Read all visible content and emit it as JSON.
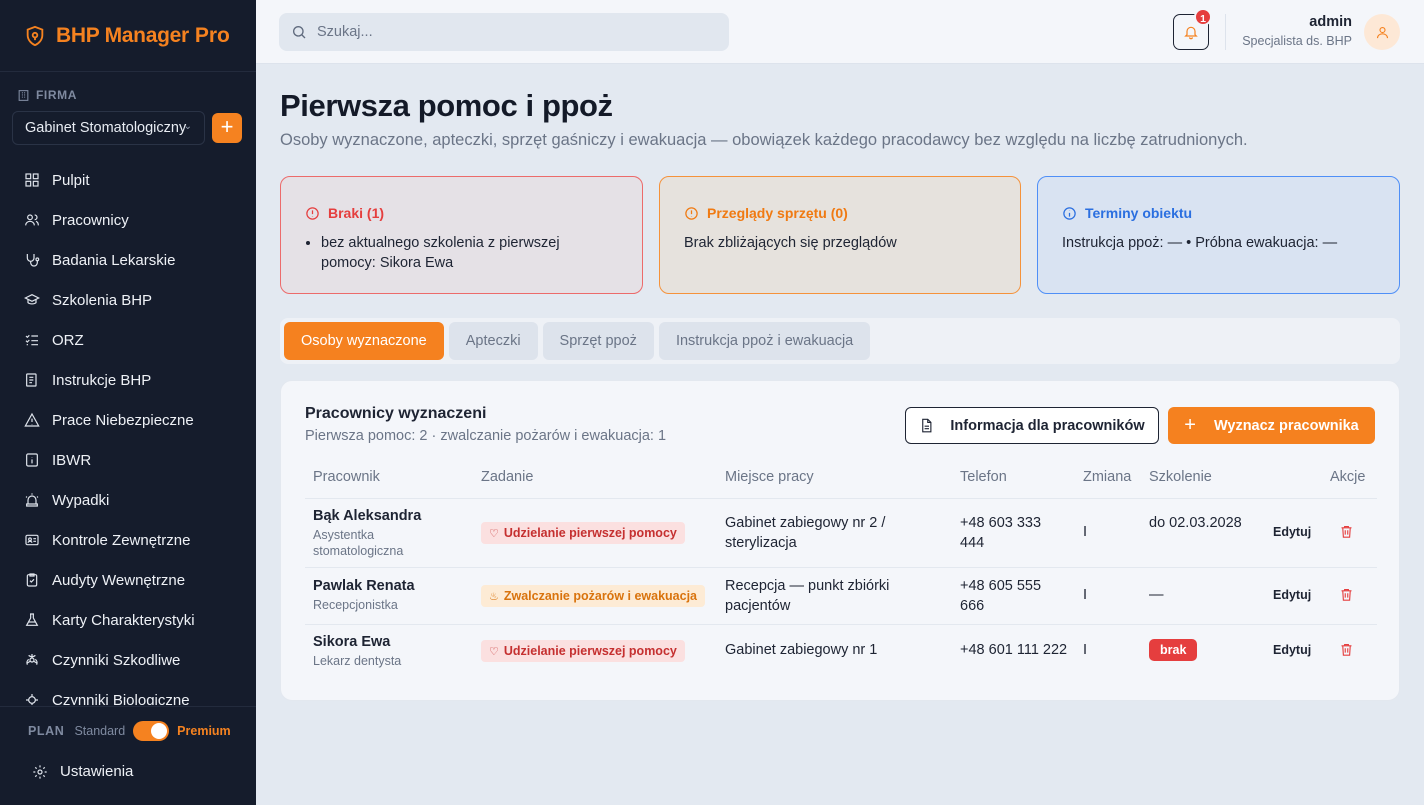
{
  "brand": {
    "name": "BHP Manager",
    "suffix": "Pro"
  },
  "sidebar": {
    "firma_label": "FIRMA",
    "company": "Gabinet Stomatologiczny",
    "add_label": "+",
    "items": [
      {
        "label": "Pulpit",
        "icon": "grid-icon"
      },
      {
        "label": "Pracownicy",
        "icon": "users-icon"
      },
      {
        "label": "Badania Lekarskie",
        "icon": "stethoscope-icon"
      },
      {
        "label": "Szkolenia BHP",
        "icon": "graduation-cap-icon"
      },
      {
        "label": "ORZ",
        "icon": "checklist-icon"
      },
      {
        "label": "Instrukcje BHP",
        "icon": "document-list-icon"
      },
      {
        "label": "Prace Niebezpieczne",
        "icon": "warning-triangle-icon"
      },
      {
        "label": "IBWR",
        "icon": "info-box-icon"
      },
      {
        "label": "Wypadki",
        "icon": "siren-icon"
      },
      {
        "label": "Kontrole Zewnętrzne",
        "icon": "id-card-icon"
      },
      {
        "label": "Audyty Wewnętrzne",
        "icon": "clipboard-check-icon"
      },
      {
        "label": "Karty Charakterystyki",
        "icon": "flask-icon"
      },
      {
        "label": "Czynniki Szkodliwe",
        "icon": "biohazard-icon"
      },
      {
        "label": "Czynniki Biologiczne",
        "icon": "microbe-icon"
      }
    ],
    "plan": {
      "label": "PLAN",
      "standard": "Standard",
      "premium": "Premium",
      "premium_on": true
    },
    "settings": "Ustawienia"
  },
  "topbar": {
    "search_placeholder": "Szukaj...",
    "notifications": "1",
    "user_name": "admin",
    "user_role": "Specjalista ds. BHP"
  },
  "page": {
    "title": "Pierwsza pomoc i ppoż",
    "subtitle": "Osoby wyznaczone, apteczki, sprzęt gaśniczy i ewakuacja — obowiązek każdego pracodawcy bez względu na liczbę zatrudnionych."
  },
  "alerts": {
    "braki": {
      "title": "Braki (1)",
      "items": [
        "bez aktualnego szkolenia z pierwszej pomocy: Sikora Ewa"
      ]
    },
    "przeglady": {
      "title": "Przeglądy sprzętu (0)",
      "body": "Brak zbliżających się przeglądów"
    },
    "terminy": {
      "title": "Terminy obiektu",
      "body": "Instrukcja ppoż: — • Próbna ewakuacja: —"
    }
  },
  "tabs": [
    "Osoby wyznaczone",
    "Apteczki",
    "Sprzęt ppoż",
    "Instrukcja ppoż i ewakuacja"
  ],
  "card": {
    "title": "Pracownicy wyznaczeni",
    "subtitle": "Pierwsza pomoc: 2 · zwalczanie pożarów i ewakuacja: 1",
    "info_button": "Informacja dla pracowników",
    "add_button": "Wyznacz pracownika",
    "columns": [
      "Pracownik",
      "Zadanie",
      "Miejsce pracy",
      "Telefon",
      "Zmiana",
      "Szkolenie",
      "Akcje"
    ],
    "rows": [
      {
        "name": "Bąk Aleksandra",
        "role": "Asystentka stomatologiczna",
        "task": "Udzielanie pierwszej pomocy",
        "task_type": "first-aid",
        "place": "Gabinet zabiegowy nr 2 / sterylizacja",
        "phone": "+48 603 333 444",
        "shift": "I",
        "training": "do 02.03.2028",
        "edit": "Edytuj"
      },
      {
        "name": "Pawlak Renata",
        "role": "Recepcjonistka",
        "task": "Zwalczanie pożarów i ewakuacja",
        "task_type": "fire",
        "place": "Recepcja — punkt zbiórki pacjentów",
        "phone": "+48 605 555 666",
        "shift": "I",
        "training": "—",
        "edit": "Edytuj"
      },
      {
        "name": "Sikora Ewa",
        "role": "Lekarz dentysta",
        "task": "Udzielanie pierwszej pomocy",
        "task_type": "first-aid",
        "place": "Gabinet zabiegowy nr 1",
        "phone": "+48 601 111 222",
        "shift": "I",
        "training": "brak",
        "edit": "Edytuj"
      }
    ]
  },
  "colors": {
    "accent": "#f5811f",
    "sidebar_bg": "#151c2c",
    "danger": "#e53e3e",
    "info": "#2b6fe0"
  }
}
